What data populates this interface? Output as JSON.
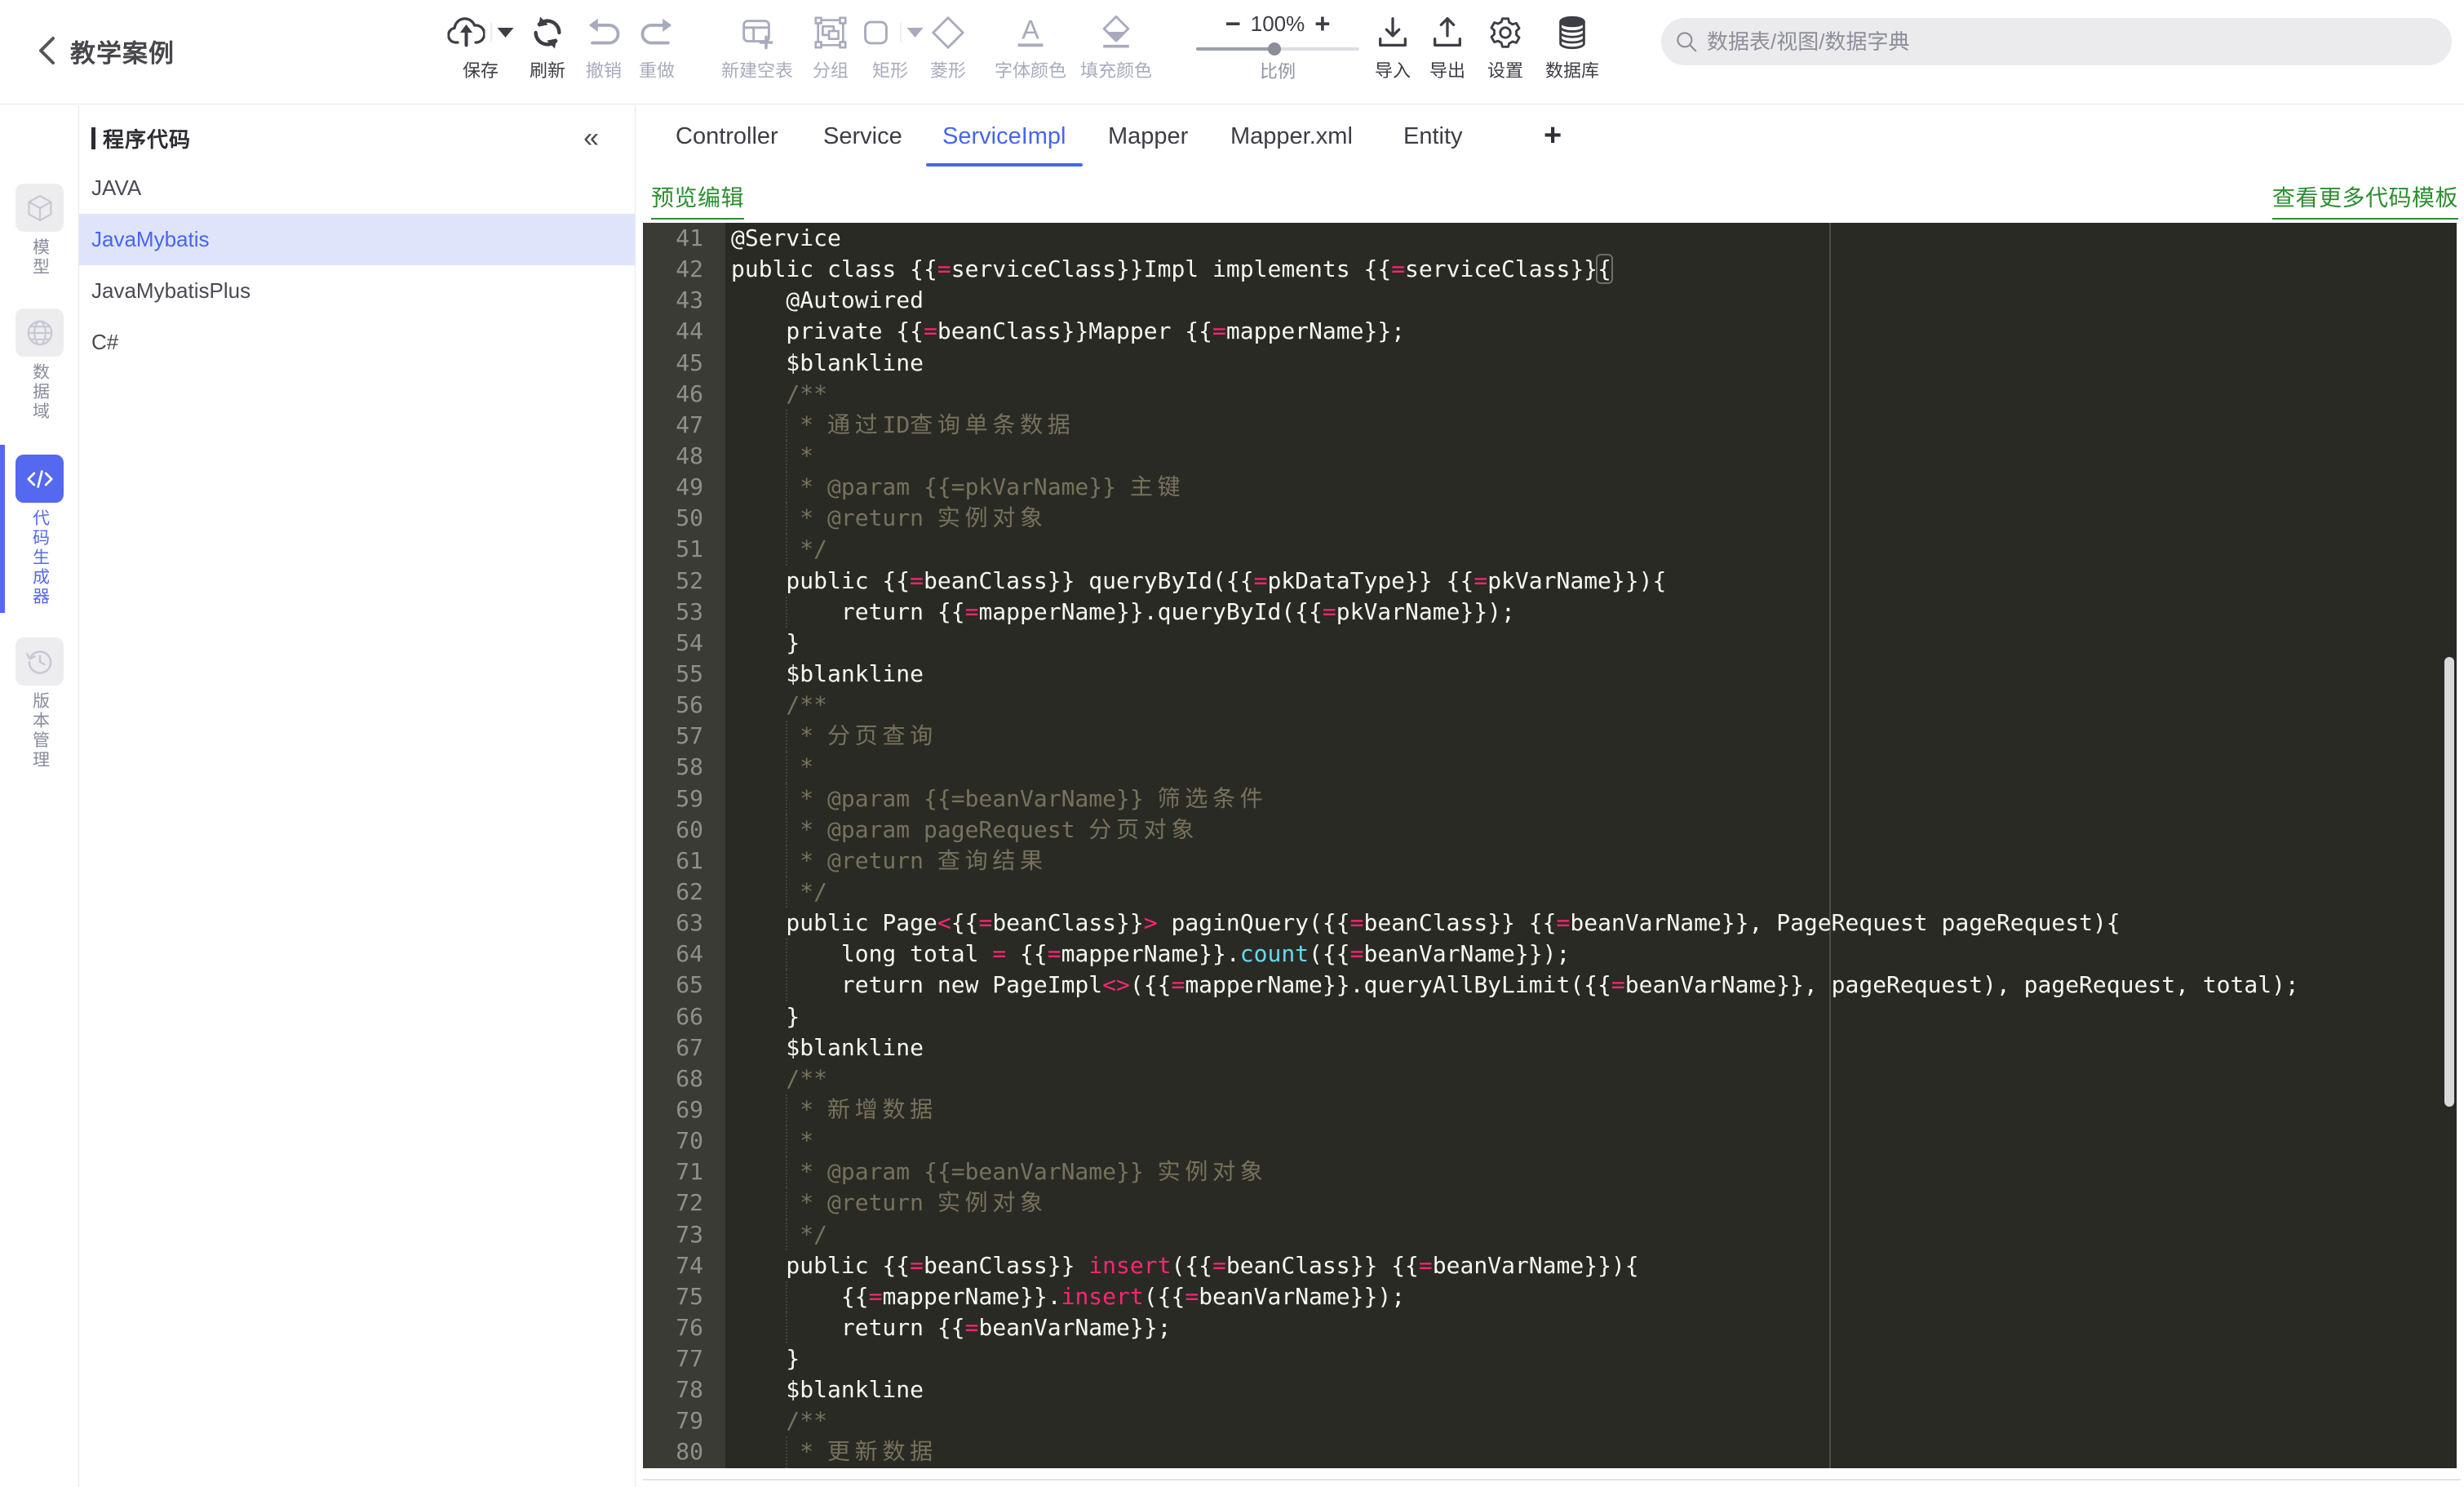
{
  "app": {
    "title": "教学案例"
  },
  "toolbar": {
    "buttons": [
      {
        "id": "save",
        "label": "保存",
        "icon": "cloud-upload",
        "caret": true,
        "enabled": true
      },
      {
        "id": "refresh",
        "label": "刷新",
        "icon": "refresh",
        "enabled": true
      },
      {
        "id": "undo",
        "label": "撤销",
        "icon": "undo",
        "enabled": false
      },
      {
        "id": "redo",
        "label": "重做",
        "icon": "redo",
        "enabled": false
      },
      {
        "id": "new-table",
        "label": "新建空表",
        "icon": "table-plus",
        "enabled": false
      },
      {
        "id": "group",
        "label": "分组",
        "icon": "group-select",
        "enabled": false
      },
      {
        "id": "rect",
        "label": "矩形",
        "icon": "rect",
        "caret": true,
        "enabled": false
      },
      {
        "id": "diamond",
        "label": "菱形",
        "icon": "diamond",
        "enabled": false
      },
      {
        "id": "font-color",
        "label": "字体颜色",
        "icon": "font-color",
        "enabled": false
      },
      {
        "id": "fill-color",
        "label": "填充颜色",
        "icon": "fill-color",
        "enabled": false
      }
    ],
    "zoom": {
      "minus": "−",
      "value": "100%",
      "plus": "+",
      "label": "比例"
    },
    "right_buttons": [
      {
        "id": "import",
        "label": "导入",
        "icon": "import"
      },
      {
        "id": "export",
        "label": "导出",
        "icon": "export"
      },
      {
        "id": "settings",
        "label": "设置",
        "icon": "gear"
      },
      {
        "id": "database",
        "label": "数据库",
        "icon": "database"
      }
    ],
    "search": {
      "placeholder": "数据表/视图/数据字典"
    }
  },
  "rail": {
    "items": [
      {
        "id": "model",
        "label": "模型",
        "icon": "cube",
        "active": false
      },
      {
        "id": "data-domain",
        "label": "数据域",
        "icon": "globe",
        "active": false
      },
      {
        "id": "code-generator",
        "label": "代码生成器",
        "icon": "code",
        "active": true
      },
      {
        "id": "version",
        "label": "版本管理",
        "icon": "history",
        "active": false
      }
    ]
  },
  "panel": {
    "title": "程序代码",
    "collapse": "«",
    "items": [
      {
        "label": "JAVA",
        "active": false
      },
      {
        "label": "JavaMybatis",
        "active": true
      },
      {
        "label": "JavaMybatisPlus",
        "active": false
      },
      {
        "label": "C#",
        "active": false
      }
    ]
  },
  "tabs": {
    "items": [
      "Controller",
      "Service",
      "ServiceImpl",
      "Mapper",
      "Mapper.xml",
      "Entity"
    ],
    "active": "ServiceImpl",
    "add": "+"
  },
  "links": {
    "preview_edit": "预览编辑",
    "more_templates": "查看更多代码模板"
  },
  "editor": {
    "first_line": 41,
    "theme": {
      "bg": "#2a2a25",
      "gutter_bg": "#3b3b35",
      "line_no": "#8f9089",
      "text": "#f8f8f2",
      "pink": "#f92672",
      "cyan": "#66d9ef",
      "comment": "#76725c",
      "ruler": "#4e4e48"
    },
    "lines": [
      [
        [
          "w",
          "@Service"
        ]
      ],
      [
        [
          "w",
          "public class {{"
        ],
        [
          "p",
          "="
        ],
        [
          "w",
          "serviceClass}}Impl implements {{"
        ],
        [
          "p",
          "="
        ],
        [
          "w",
          "serviceClass}}"
        ],
        [
          "wb",
          "{"
        ]
      ],
      [
        [
          "w",
          "    @Autowired"
        ]
      ],
      [
        [
          "w",
          "    private {{"
        ],
        [
          "p",
          "="
        ],
        [
          "w",
          "beanClass}}Mapper {{"
        ],
        [
          "p",
          "="
        ],
        [
          "w",
          "mapperName}};"
        ]
      ],
      [
        [
          "w",
          "    $blankline"
        ]
      ],
      [
        [
          "m",
          "    /**"
        ]
      ],
      [
        [
          "m",
          "     * 通过ID查询单条数据"
        ]
      ],
      [
        [
          "m",
          "     *"
        ]
      ],
      [
        [
          "m",
          "     * @param {{=pkVarName}} 主键"
        ]
      ],
      [
        [
          "m",
          "     * @return 实例对象"
        ]
      ],
      [
        [
          "m",
          "     */"
        ]
      ],
      [
        [
          "w",
          "    public {{"
        ],
        [
          "p",
          "="
        ],
        [
          "w",
          "beanClass}} queryById({{"
        ],
        [
          "p",
          "="
        ],
        [
          "w",
          "pkDataType}} {{"
        ],
        [
          "p",
          "="
        ],
        [
          "w",
          "pkVarName}}){"
        ]
      ],
      [
        [
          "w",
          "        return {{"
        ],
        [
          "p",
          "="
        ],
        [
          "w",
          "mapperName}}.queryById({{"
        ],
        [
          "p",
          "="
        ],
        [
          "w",
          "pkVarName}});"
        ]
      ],
      [
        [
          "w",
          "    }"
        ]
      ],
      [
        [
          "w",
          "    $blankline"
        ]
      ],
      [
        [
          "m",
          "    /**"
        ]
      ],
      [
        [
          "m",
          "     * 分页查询"
        ]
      ],
      [
        [
          "m",
          "     *"
        ]
      ],
      [
        [
          "m",
          "     * @param {{=beanVarName}} 筛选条件"
        ]
      ],
      [
        [
          "m",
          "     * @param pageRequest 分页对象"
        ]
      ],
      [
        [
          "m",
          "     * @return 查询结果"
        ]
      ],
      [
        [
          "m",
          "     */"
        ]
      ],
      [
        [
          "w",
          "    public Page"
        ],
        [
          "p",
          "<"
        ],
        [
          "w",
          "{{"
        ],
        [
          "p",
          "="
        ],
        [
          "w",
          "beanClass}}"
        ],
        [
          "p",
          ">"
        ],
        [
          "w",
          " paginQuery({{"
        ],
        [
          "p",
          "="
        ],
        [
          "w",
          "beanClass}} {{"
        ],
        [
          "p",
          "="
        ],
        [
          "w",
          "beanVarName}}, PageRequest pageRequest){"
        ]
      ],
      [
        [
          "w",
          "        long total "
        ],
        [
          "p",
          "="
        ],
        [
          "w",
          " {{"
        ],
        [
          "p",
          "="
        ],
        [
          "w",
          "mapperName}}."
        ],
        [
          "c",
          "count"
        ],
        [
          "w",
          "({{"
        ],
        [
          "p",
          "="
        ],
        [
          "w",
          "beanVarName}});"
        ]
      ],
      [
        [
          "w",
          "        return new PageImpl"
        ],
        [
          "p",
          "<>"
        ],
        [
          "w",
          "({{"
        ],
        [
          "p",
          "="
        ],
        [
          "w",
          "mapperName}}.queryAllByLimit({{"
        ],
        [
          "p",
          "="
        ],
        [
          "w",
          "beanVarName}}, pageRequest), pageRequest, total);"
        ]
      ],
      [
        [
          "w",
          "    }"
        ]
      ],
      [
        [
          "w",
          "    $blankline"
        ]
      ],
      [
        [
          "m",
          "    /**"
        ]
      ],
      [
        [
          "m",
          "     * 新增数据"
        ]
      ],
      [
        [
          "m",
          "     *"
        ]
      ],
      [
        [
          "m",
          "     * @param {{=beanVarName}} 实例对象"
        ]
      ],
      [
        [
          "m",
          "     * @return 实例对象"
        ]
      ],
      [
        [
          "m",
          "     */"
        ]
      ],
      [
        [
          "w",
          "    public {{"
        ],
        [
          "p",
          "="
        ],
        [
          "w",
          "beanClass}} "
        ],
        [
          "p",
          "insert"
        ],
        [
          "w",
          "({{"
        ],
        [
          "p",
          "="
        ],
        [
          "w",
          "beanClass}} {{"
        ],
        [
          "p",
          "="
        ],
        [
          "w",
          "beanVarName}}){"
        ]
      ],
      [
        [
          "w",
          "        {{"
        ],
        [
          "p",
          "="
        ],
        [
          "w",
          "mapperName}}."
        ],
        [
          "p",
          "insert"
        ],
        [
          "w",
          "({{"
        ],
        [
          "p",
          "="
        ],
        [
          "w",
          "beanVarName}});"
        ]
      ],
      [
        [
          "w",
          "        return {{"
        ],
        [
          "p",
          "="
        ],
        [
          "w",
          "beanVarName}};"
        ]
      ],
      [
        [
          "w",
          "    }"
        ]
      ],
      [
        [
          "w",
          "    $blankline"
        ]
      ],
      [
        [
          "m",
          "    /**"
        ]
      ],
      [
        [
          "m",
          "     * 更新数据"
        ]
      ]
    ]
  },
  "accent": {
    "blue": "#4566f1",
    "green": "#2e8e31"
  }
}
